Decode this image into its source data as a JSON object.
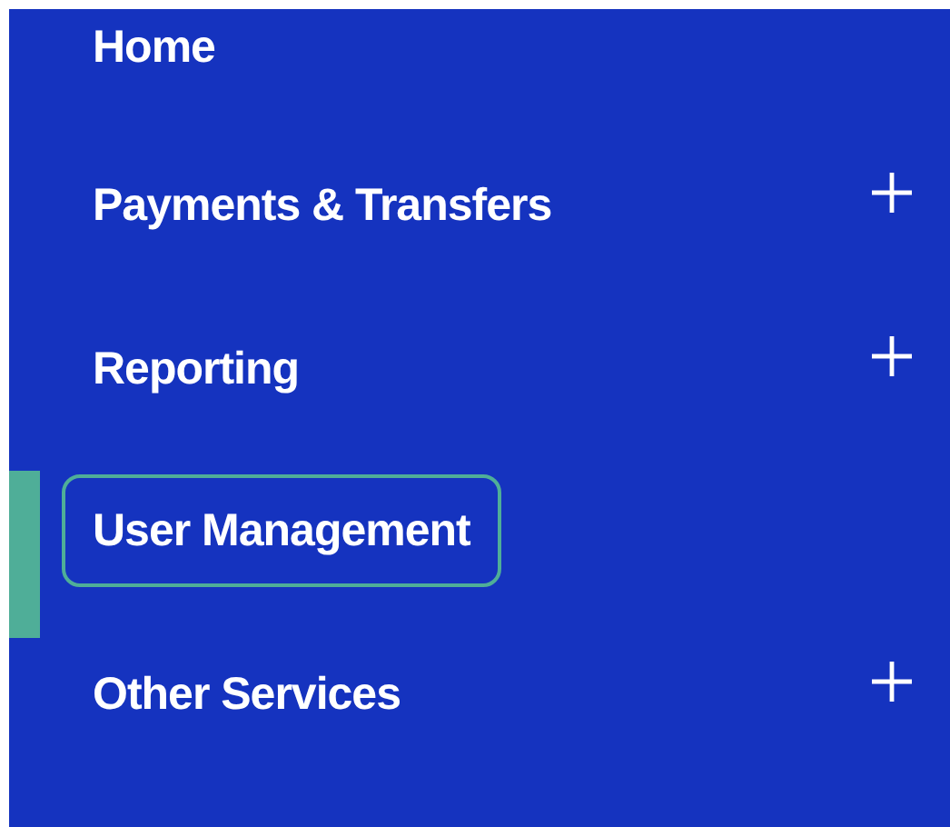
{
  "menu": {
    "items": [
      {
        "label": "Home",
        "expandable": false,
        "selected": false
      },
      {
        "label": "Payments & Transfers",
        "expandable": true,
        "selected": false
      },
      {
        "label": "Reporting",
        "expandable": true,
        "selected": false
      },
      {
        "label": "User Management",
        "expandable": false,
        "selected": true
      },
      {
        "label": "Other Services",
        "expandable": true,
        "selected": false
      }
    ]
  }
}
